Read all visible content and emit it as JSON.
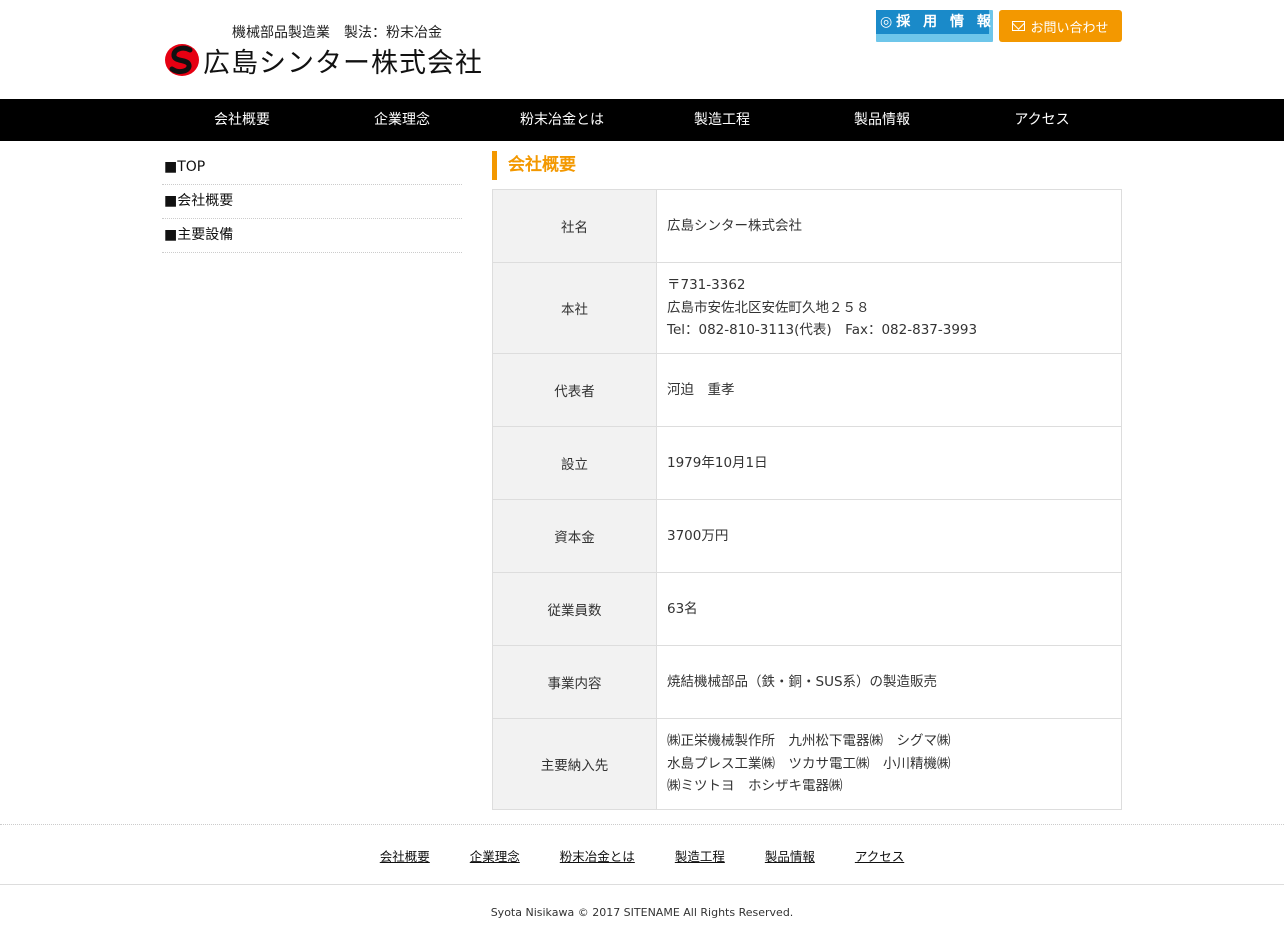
{
  "header": {
    "tagline": "機械部品製造業　製法：粉末冶金",
    "company_name": "広島シンター株式会社",
    "recruit_label": "◎採 用 情 報",
    "contact_label": "お問い合わせ",
    "logo_mark": "S"
  },
  "colors": {
    "accent": "#f39800",
    "nav_bg": "#000000",
    "recruit_bg": "#1a8ac9",
    "table_header_bg": "#f2f2f2"
  },
  "global_nav": [
    "会社概要",
    "企業理念",
    "粉末冶金とは",
    "製造工程",
    "製品情報",
    "アクセス"
  ],
  "sidebar": {
    "items": [
      "■TOP",
      "■会社概要",
      "■主要設備"
    ]
  },
  "main": {
    "title": "会社概要",
    "rows": [
      {
        "label": "社名",
        "value": "広島シンター株式会社"
      },
      {
        "label": "本社",
        "value": "〒731-3362\n広島市安佐北区安佐町久地２５８\nTel：082-810-3113(代表)　Fax：082-837-3993"
      },
      {
        "label": "代表者",
        "value": "河迫　重孝"
      },
      {
        "label": "設立",
        "value": "1979年10月1日"
      },
      {
        "label": "資本金",
        "value": "3700万円"
      },
      {
        "label": "従業員数",
        "value": "63名"
      },
      {
        "label": "事業内容",
        "value": "焼結機械部品（鉄・銅・SUS系）の製造販売"
      },
      {
        "label": "主要納入先",
        "value": "㈱正栄機械製作所　九州松下電器㈱　シグマ㈱\n水島プレス工業㈱　ツカサ電工㈱　小川精機㈱\n㈱ミツトヨ　ホシザキ電器㈱"
      }
    ]
  },
  "footer": {
    "nav": [
      "会社概要",
      "企業理念",
      "粉末冶金とは",
      "製造工程",
      "製品情報",
      "アクセス"
    ],
    "copyright": "Syota Nisikawa © 2017 SITENAME All Rights Reserved."
  }
}
